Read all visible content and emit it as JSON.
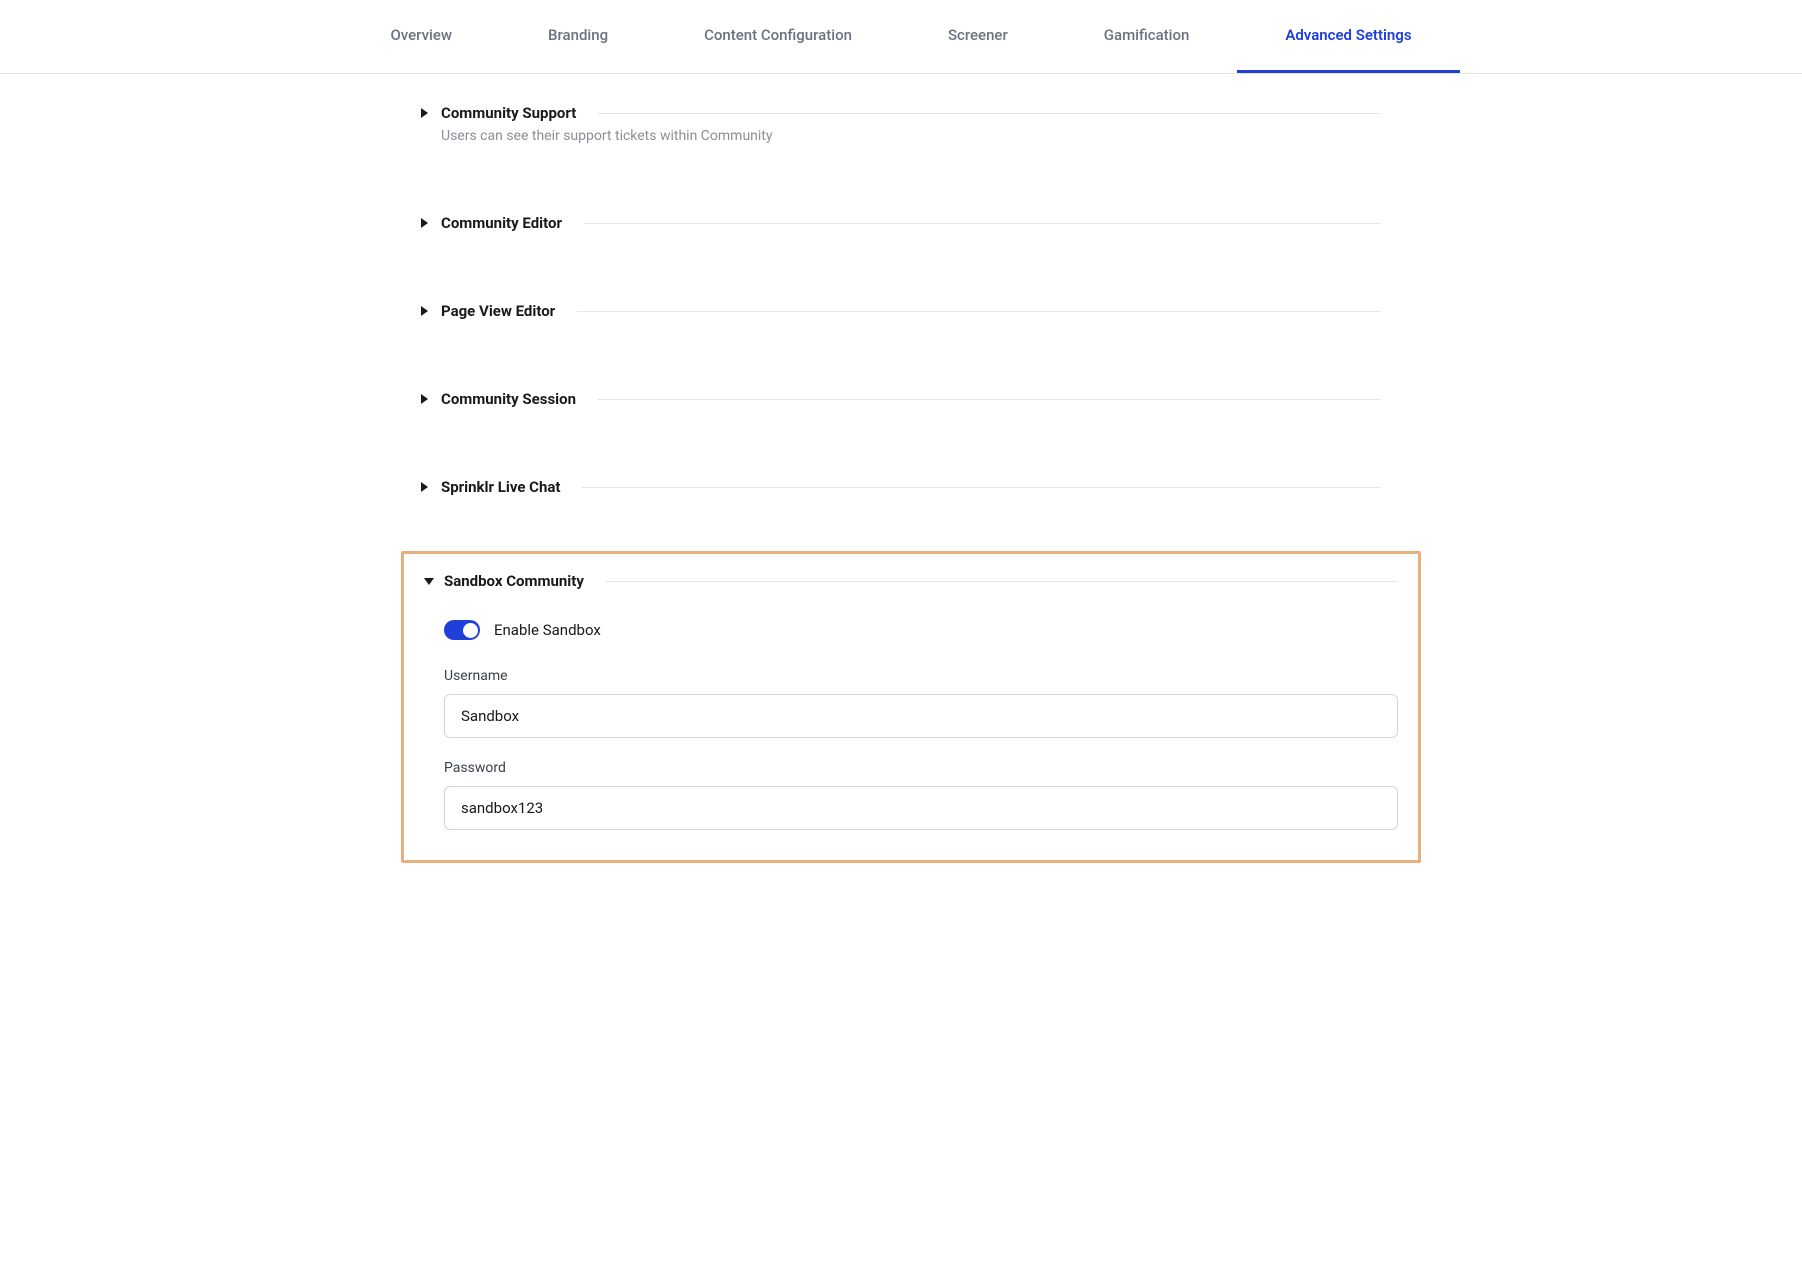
{
  "tabs": [
    {
      "label": "Overview",
      "active": false
    },
    {
      "label": "Branding",
      "active": false
    },
    {
      "label": "Content Configuration",
      "active": false
    },
    {
      "label": "Screener",
      "active": false
    },
    {
      "label": "Gamification",
      "active": false
    },
    {
      "label": "Advanced Settings",
      "active": true
    }
  ],
  "sections": {
    "community_support": {
      "title": "Community Support",
      "subtitle": "Users can see their support tickets within Community"
    },
    "community_editor": {
      "title": "Community Editor"
    },
    "page_view_editor": {
      "title": "Page View Editor"
    },
    "community_session": {
      "title": "Community Session"
    },
    "sprinklr_live_chat": {
      "title": "Sprinklr Live Chat"
    },
    "sandbox_community": {
      "title": "Sandbox Community",
      "enable_label": "Enable Sandbox",
      "enable_value": true,
      "username_label": "Username",
      "username_value": "Sandbox",
      "password_label": "Password",
      "password_value": "sandbox123"
    }
  }
}
